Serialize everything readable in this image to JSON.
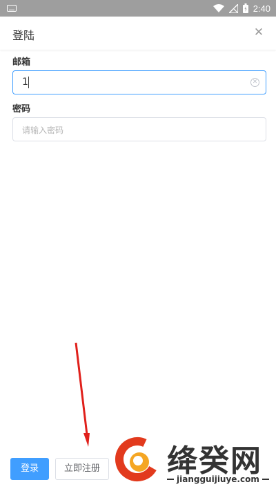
{
  "status_bar": {
    "time": "2:40"
  },
  "header": {
    "title": "登陆"
  },
  "form": {
    "email": {
      "label": "邮箱",
      "value": "1"
    },
    "password": {
      "label": "密码",
      "placeholder": "请输入密码"
    }
  },
  "actions": {
    "login_label": "登录",
    "register_label": "立即注册"
  },
  "watermark": {
    "name": "绛癸网",
    "url": "jiangguijiuye.com"
  },
  "colors": {
    "primary": "#409eff",
    "status_bar": "#9e9e9e",
    "annotation_arrow": "#e0201b"
  }
}
